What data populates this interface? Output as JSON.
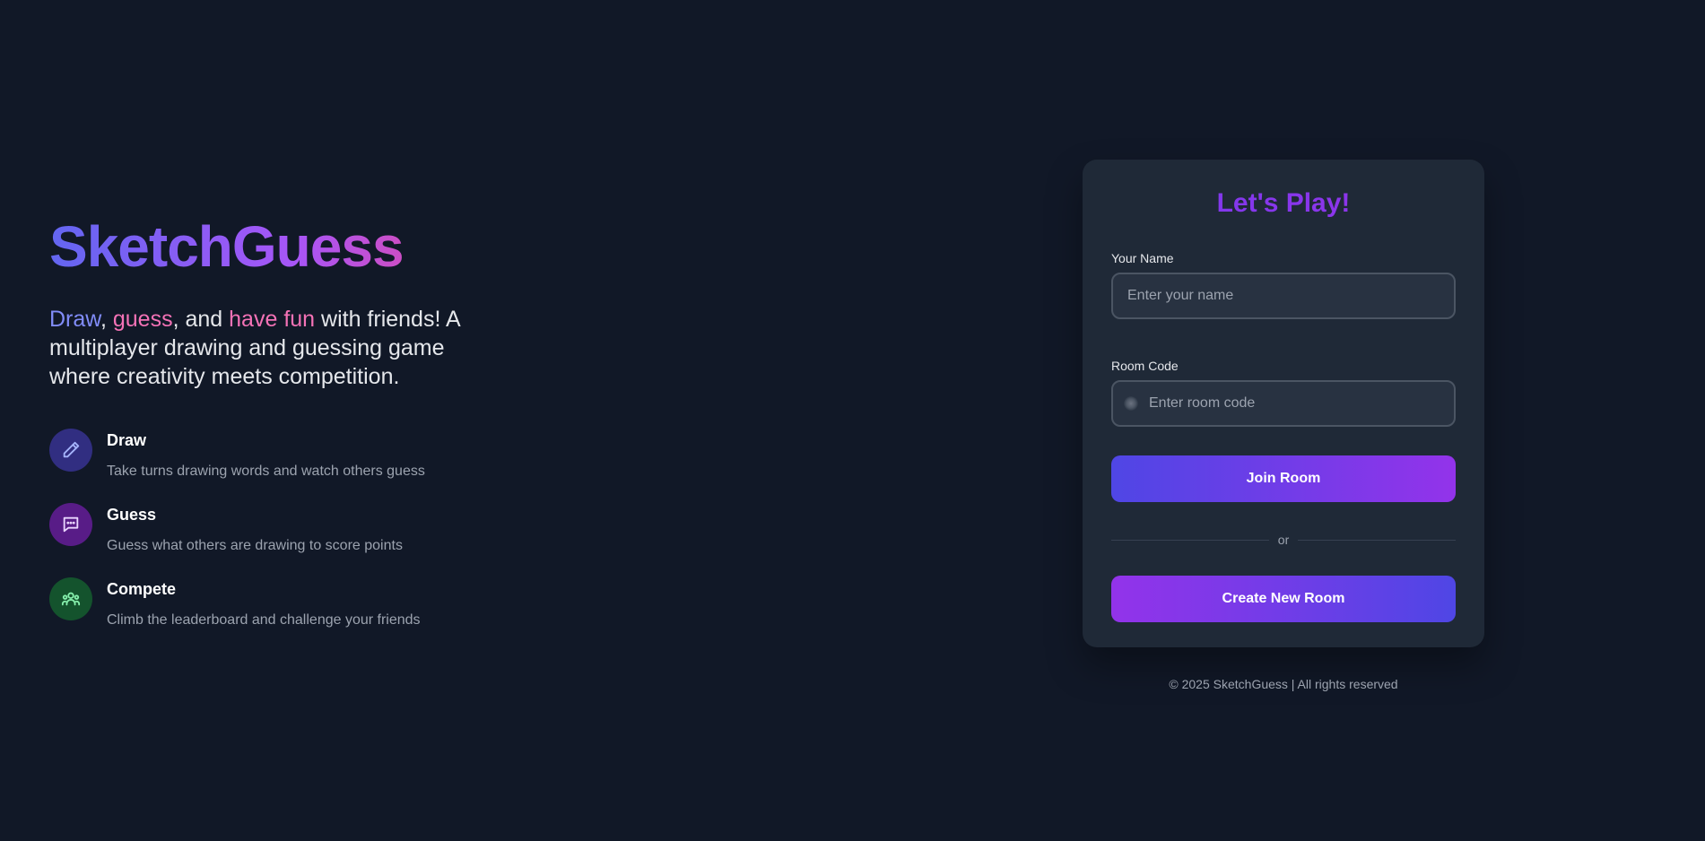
{
  "brand": {
    "name": "SketchGuess"
  },
  "tagline": {
    "word_draw": "Draw",
    "sep1": ", ",
    "word_guess": "guess",
    "sep2": ", and ",
    "word_fun": "have fun",
    "rest": " with friends! A multiplayer drawing and guessing game where creativity meets competition."
  },
  "features": [
    {
      "icon": "pencil-icon",
      "title": "Draw",
      "desc": "Take turns drawing words and watch others guess"
    },
    {
      "icon": "chat-icon",
      "title": "Guess",
      "desc": "Guess what others are drawing to score points"
    },
    {
      "icon": "users-icon",
      "title": "Compete",
      "desc": "Climb the leaderboard and challenge your friends"
    }
  ],
  "card": {
    "title": "Let's Play!",
    "name_label": "Your Name",
    "name_placeholder": "Enter your name",
    "name_value": "",
    "room_label": "Room Code",
    "room_placeholder": "Enter room code",
    "room_value": "",
    "join_label": "Join Room",
    "divider_text": "or",
    "create_label": "Create New Room"
  },
  "footer": {
    "text": "© 2025 SketchGuess | All rights reserved"
  },
  "colors": {
    "background": "#111827",
    "card": "#1f2937",
    "accent_indigo": "#4f46e5",
    "accent_purple": "#9333ea",
    "accent_pink": "#ec4899"
  }
}
